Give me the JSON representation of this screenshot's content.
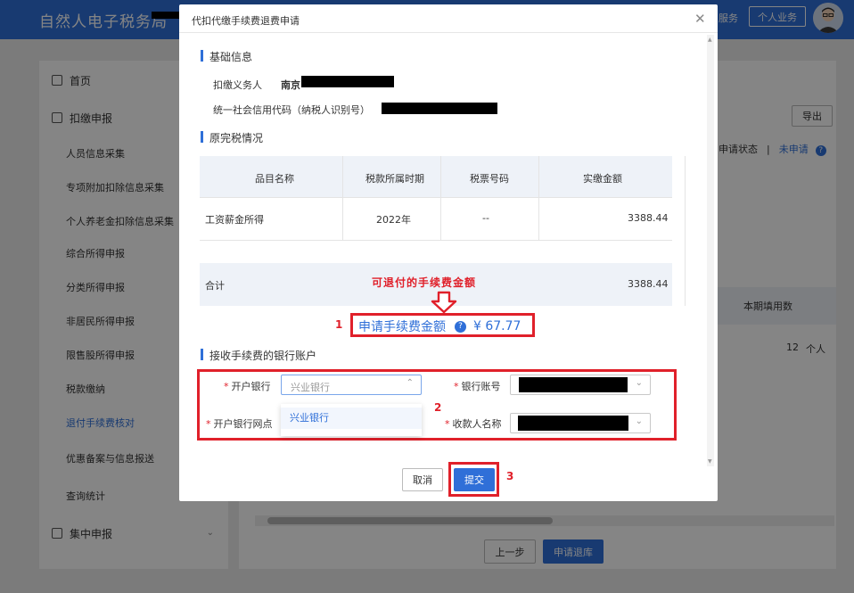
{
  "app": {
    "title": "自然人电子税务局",
    "top_service": "服务",
    "top_personal": "个人业务"
  },
  "sidebar": {
    "items": [
      {
        "label": "首页"
      },
      {
        "label": "扣缴申报"
      },
      {
        "label": "人员信息采集"
      },
      {
        "label": "专项附加扣除信息采集"
      },
      {
        "label": "个人养老金扣除信息采集"
      },
      {
        "label": "综合所得申报"
      },
      {
        "label": "分类所得申报"
      },
      {
        "label": "非居民所得申报"
      },
      {
        "label": "限售股所得申报"
      },
      {
        "label": "税款缴纳"
      },
      {
        "label": "退付手续费核对"
      },
      {
        "label": "优惠备案与信息报送"
      },
      {
        "label": "查询统计"
      },
      {
        "label": "集中申报"
      }
    ]
  },
  "background": {
    "export_label": "导出",
    "status_label": "申请状态",
    "status_sep": "|",
    "status_value": "未申请",
    "col_current": "本期填用数",
    "row_number": "12",
    "row_person": "个人",
    "prev_label": "上一步",
    "refund_label": "申请退库"
  },
  "modal": {
    "title": "代扣代缴手续费退费申请",
    "basic_section": "基础信息",
    "agent_label": "扣缴义务人",
    "agent_value": "南京",
    "credit_label": "统一社会信用代码（纳税人识别号）",
    "tax_section": "原完税情况",
    "table": {
      "headers": [
        "品目名称",
        "税款所属时期",
        "税票号码",
        "实缴金额"
      ],
      "rows": [
        [
          "工资薪金所得",
          "2022年",
          "--",
          "3388.44"
        ]
      ],
      "total_label": "合计",
      "total_value": "3388.44"
    },
    "annotation_refundable": "可退付的手续费金额",
    "fee_label": "申请手续费金额",
    "fee_value": "¥ 67.77",
    "bank_section": "接收手续费的银行账户",
    "bank_label": "开户银行",
    "bank_value": "兴业银行",
    "account_label": "银行账号",
    "branch_label": "开户银行网点",
    "payee_label": "收款人名称",
    "dropdown_option": "兴业银行",
    "cancel_label": "取消",
    "submit_label": "提交"
  },
  "annotations": {
    "num1": "1",
    "num2": "2",
    "num3": "3"
  },
  "colors": {
    "brand_blue": "#2f6fd8",
    "annotation_red": "#e0202a"
  }
}
